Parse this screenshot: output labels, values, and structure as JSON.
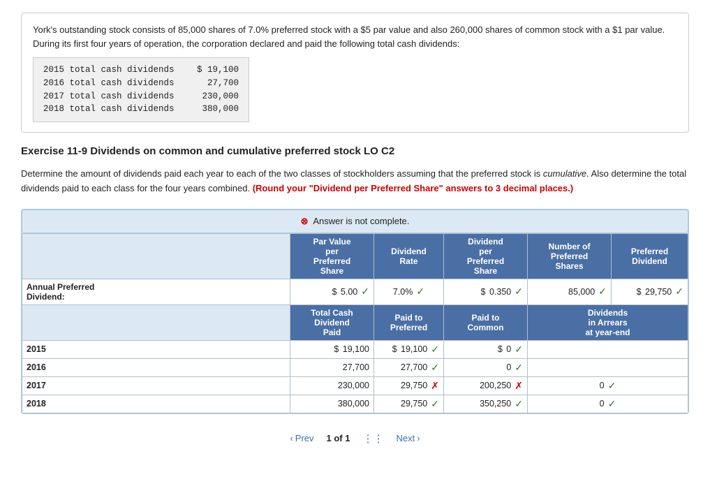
{
  "info": {
    "text": "York's outstanding stock consists of 85,000 shares of 7.0% preferred stock with a $5 par value and also 260,000 shares of common stock with a $1 par value. During its first four years of operation, the corporation declared and paid the following total cash dividends:"
  },
  "dividends": [
    {
      "label": "2015 total cash dividends",
      "value": "$  19,100"
    },
    {
      "label": "2016 total cash dividends",
      "value": "   27,700"
    },
    {
      "label": "2017 total cash dividends",
      "value": "  230,000"
    },
    {
      "label": "2018 total cash dividends",
      "value": "  380,000"
    }
  ],
  "exercise": {
    "title": "Exercise 11-9 Dividends on common and cumulative preferred stock LO C2",
    "instructions_part1": "Determine the amount of dividends paid each year to each of the two classes of stockholders assuming that the preferred stock is ",
    "instructions_italic": "cumulative",
    "instructions_part2": ". Also determine the total dividends paid to each class for the four years combined. ",
    "instructions_highlight": "(Round your \"Dividend per Preferred Share\" answers to 3 decimal places.)"
  },
  "banner": {
    "icon": "⊗",
    "text": "Answer is not complete."
  },
  "table": {
    "headers_top": [
      {
        "label": "Par Value per Preferred Share",
        "colspan": 1
      },
      {
        "label": "Dividend Rate",
        "colspan": 1
      },
      {
        "label": "Dividend per Preferred Share",
        "colspan": 1
      },
      {
        "label": "Number of Preferred Shares",
        "colspan": 1
      },
      {
        "label": "Preferred Dividend",
        "colspan": 1
      }
    ],
    "annual_row": {
      "label": "Annual Preferred Dividend:",
      "par_value_prefix": "$",
      "par_value": "5.00",
      "par_check": "green",
      "dividend_rate": "7.0%",
      "rate_check": "green",
      "dps_prefix": "$",
      "dps": "0.350",
      "dps_check": "green",
      "shares": "85,000",
      "shares_check": "green",
      "preferred_prefix": "$",
      "preferred": "29,750",
      "preferred_check": "green"
    },
    "headers_secondary": [
      {
        "label": "Total Cash Dividend Paid"
      },
      {
        "label": "Paid to Preferred"
      },
      {
        "label": "Paid to Common"
      },
      {
        "label": "Dividends in Arrears at year-end"
      }
    ],
    "year_rows": [
      {
        "year": "2015",
        "total_prefix": "$",
        "total": "19,100",
        "paid_pref_prefix": "$",
        "paid_pref": "19,100",
        "paid_pref_check": "green",
        "paid_comm_prefix": "$",
        "paid_comm": "0",
        "paid_comm_check": "green",
        "arrears": "",
        "arrears_check": ""
      },
      {
        "year": "2016",
        "total_prefix": "",
        "total": "27,700",
        "paid_pref_prefix": "",
        "paid_pref": "27,700",
        "paid_pref_check": "green",
        "paid_comm_prefix": "",
        "paid_comm": "0",
        "paid_comm_check": "green",
        "arrears": "",
        "arrears_check": ""
      },
      {
        "year": "2017",
        "total_prefix": "",
        "total": "230,000",
        "paid_pref_prefix": "",
        "paid_pref": "29,750",
        "paid_pref_check": "red",
        "paid_comm_prefix": "",
        "paid_comm": "200,250",
        "paid_comm_check": "red",
        "arrears": "0",
        "arrears_check": "green"
      },
      {
        "year": "2018",
        "total_prefix": "",
        "total": "380,000",
        "paid_pref_prefix": "",
        "paid_pref": "29,750",
        "paid_pref_check": "green",
        "paid_comm_prefix": "",
        "paid_comm": "350,250",
        "paid_comm_check": "green",
        "arrears": "0",
        "arrears_check": "green"
      }
    ]
  },
  "pagination": {
    "prev_label": "Prev",
    "page_info": "1 of 1",
    "next_label": "Next"
  }
}
